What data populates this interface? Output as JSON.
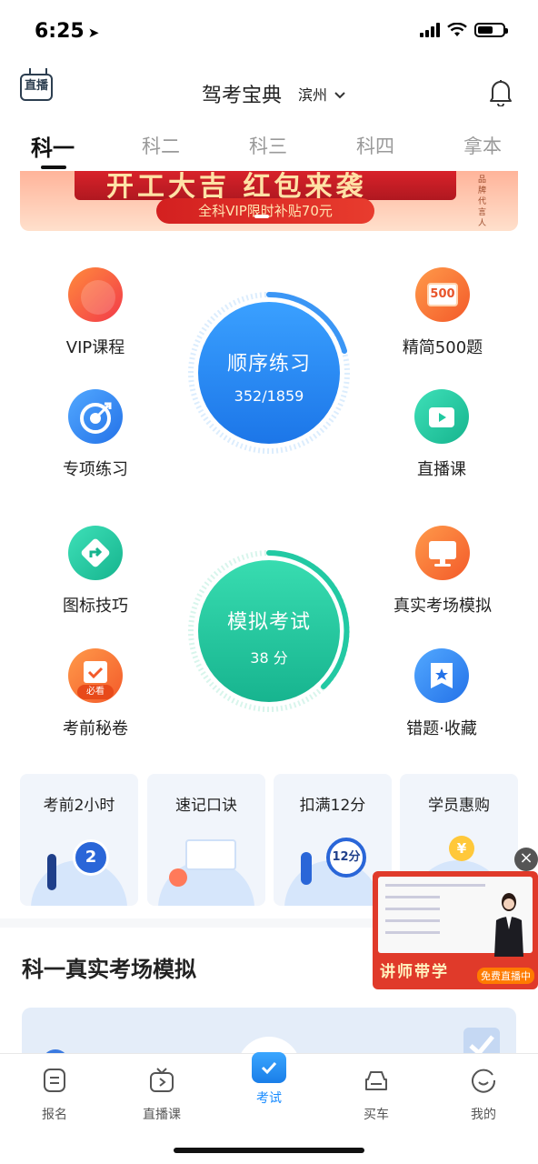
{
  "status_bar": {
    "time": "6:25"
  },
  "header": {
    "live_label": "直播",
    "title": "驾考宝典",
    "city": "滨州"
  },
  "subject_tabs": [
    {
      "label": "科一",
      "active": true
    },
    {
      "label": "科二"
    },
    {
      "label": "科三"
    },
    {
      "label": "科四"
    },
    {
      "label": "拿本"
    }
  ],
  "banner": {
    "headline": "开工大吉 红包来袭",
    "pill": "全科VIP限时补贴70元",
    "side_text": "品牌代言人"
  },
  "features": {
    "vip_course": "VIP课程",
    "special_practice": "专项练习",
    "concise_500": "精简500题",
    "concise_500_badge": "500",
    "live_course": "直播课",
    "sign_skills": "图标技巧",
    "pre_exam_secrets": "考前秘卷",
    "pre_exam_badge": "必看",
    "real_exam_sim": "真实考场模拟",
    "wrong_favorites": "错题·收藏"
  },
  "sequential_practice": {
    "title": "顺序练习",
    "progress_text": "352/1859",
    "done": 352,
    "total": 1859
  },
  "mock_exam": {
    "title": "模拟考试",
    "score_text": "38 分"
  },
  "quick_cards": [
    {
      "label": "考前2小时",
      "badge": "2"
    },
    {
      "label": "速记口诀"
    },
    {
      "label": "扣满12分",
      "badge": "12分"
    },
    {
      "label": "学员惠购",
      "badge": "¥"
    }
  ],
  "section": {
    "title": "科一真实考场模拟"
  },
  "promo": {
    "title": "讲师带学",
    "badge": "免费直播中"
  },
  "tabbar": [
    {
      "label": "报名"
    },
    {
      "label": "直播课"
    },
    {
      "label": "考试",
      "active": true
    },
    {
      "label": "买车"
    },
    {
      "label": "我的"
    }
  ],
  "colors": {
    "accent": "#1a8cff",
    "primary_blue": "#2e8cf2",
    "mint": "#20c9a0",
    "orange": "#ff6a2a"
  }
}
